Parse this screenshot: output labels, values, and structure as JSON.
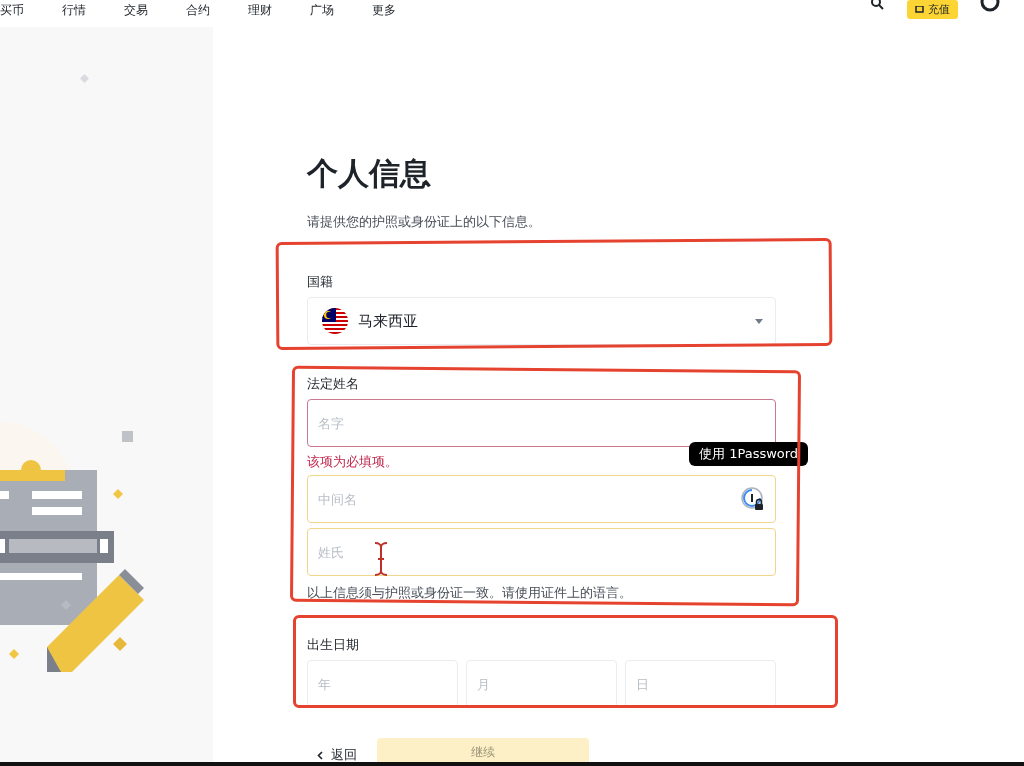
{
  "header": {
    "nav_items": [
      "买币",
      "行情",
      "交易",
      "合约",
      "理财",
      "广场",
      "更多"
    ],
    "deposit_button": "充值"
  },
  "form": {
    "title": "个人信息",
    "subtitle": "请提供您的护照或身份证上的以下信息。",
    "nationality": {
      "label": "国籍",
      "value": "马来西亚"
    },
    "legal_name": {
      "label": "法定姓名",
      "fields": [
        {
          "placeholder": "名字",
          "invalid": true,
          "focused": false
        },
        {
          "placeholder": "中间名",
          "invalid": false,
          "focused": true
        },
        {
          "placeholder": "姓氏",
          "invalid": false,
          "focused": true
        }
      ],
      "error": "该项为必填项。",
      "note": "以上信息须与护照或身份证一致。请使用证件上的语言。"
    },
    "tooltip": "使用 1Password",
    "birth_date": {
      "label": "出生日期",
      "fields": [
        {
          "placeholder": "年"
        },
        {
          "placeholder": "月"
        },
        {
          "placeholder": "日"
        }
      ]
    },
    "back": "返回",
    "continue": {
      "label": "继续",
      "disabled": true
    }
  }
}
